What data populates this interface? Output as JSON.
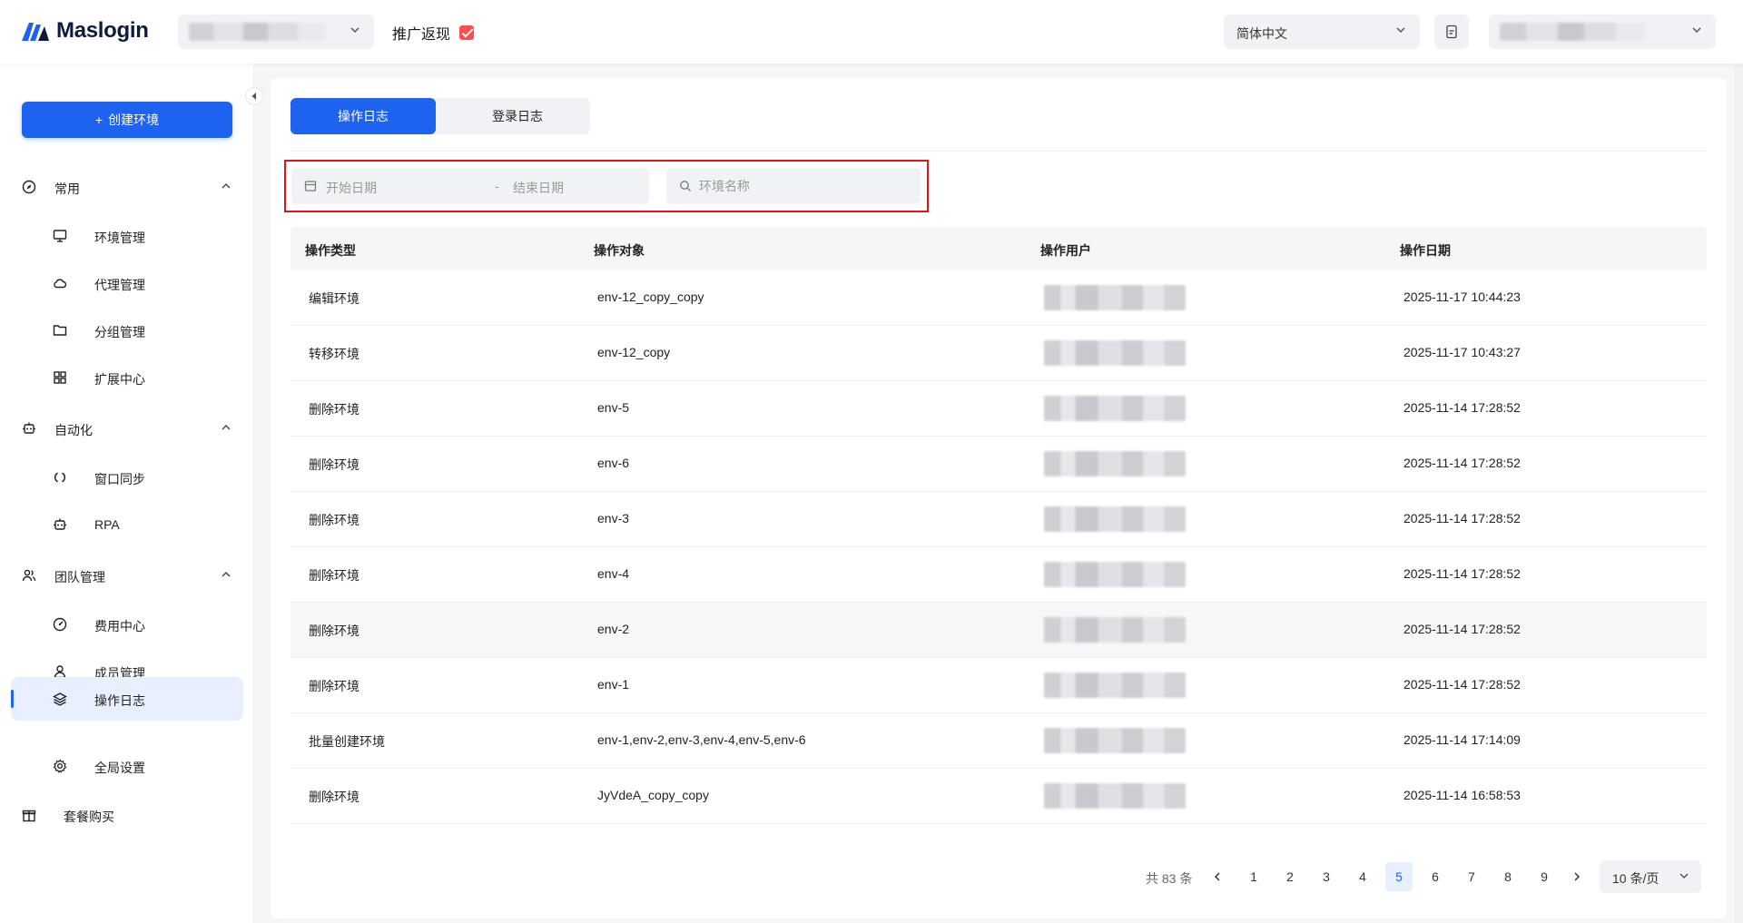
{
  "header": {
    "brand": "Maslogin",
    "promo_label": "推广返现",
    "language": "简体中文"
  },
  "sidebar": {
    "create_label": "创建环境",
    "groups": [
      {
        "label": "常用",
        "items": [
          "环境管理",
          "代理管理",
          "分组管理",
          "扩展中心"
        ]
      },
      {
        "label": "自动化",
        "items": [
          "窗口同步",
          "RPA"
        ]
      },
      {
        "label": "团队管理",
        "items": [
          "费用中心",
          "成员管理",
          "操作日志",
          "全局设置"
        ]
      }
    ],
    "solo_label": "套餐购买",
    "active_item": "操作日志"
  },
  "tabs": [
    {
      "label": "操作日志",
      "active": true
    },
    {
      "label": "登录日志",
      "active": false
    }
  ],
  "filters": {
    "start_placeholder": "开始日期",
    "separator": "-",
    "end_placeholder": "结束日期",
    "search_placeholder": "环境名称"
  },
  "table": {
    "columns": [
      "操作类型",
      "操作对象",
      "操作用户",
      "操作日期"
    ],
    "rows": [
      {
        "type": "编辑环境",
        "target": "env-12_copy_copy",
        "date": "2025-11-17 10:44:23"
      },
      {
        "type": "转移环境",
        "target": "env-12_copy",
        "date": "2025-11-17 10:43:27"
      },
      {
        "type": "删除环境",
        "target": "env-5",
        "date": "2025-11-14 17:28:52"
      },
      {
        "type": "删除环境",
        "target": "env-6",
        "date": "2025-11-14 17:28:52"
      },
      {
        "type": "删除环境",
        "target": "env-3",
        "date": "2025-11-14 17:28:52"
      },
      {
        "type": "删除环境",
        "target": "env-4",
        "date": "2025-11-14 17:28:52"
      },
      {
        "type": "删除环境",
        "target": "env-2",
        "date": "2025-11-14 17:28:52"
      },
      {
        "type": "删除环境",
        "target": "env-1",
        "date": "2025-11-14 17:28:52"
      },
      {
        "type": "批量创建环境",
        "target": "env-1,env-2,env-3,env-4,env-5,env-6",
        "date": "2025-11-14 17:14:09"
      },
      {
        "type": "删除环境",
        "target": "JyVdeA_copy_copy",
        "date": "2025-11-14 16:58:53"
      }
    ]
  },
  "pagination": {
    "total_label": "共 83 条",
    "pages": [
      "1",
      "2",
      "3",
      "4",
      "5",
      "6",
      "7",
      "8",
      "9"
    ],
    "current": "5",
    "page_size": "10 条/页"
  },
  "colors": {
    "accent": "#1e62f0",
    "highlight_border": "#e5121a"
  }
}
